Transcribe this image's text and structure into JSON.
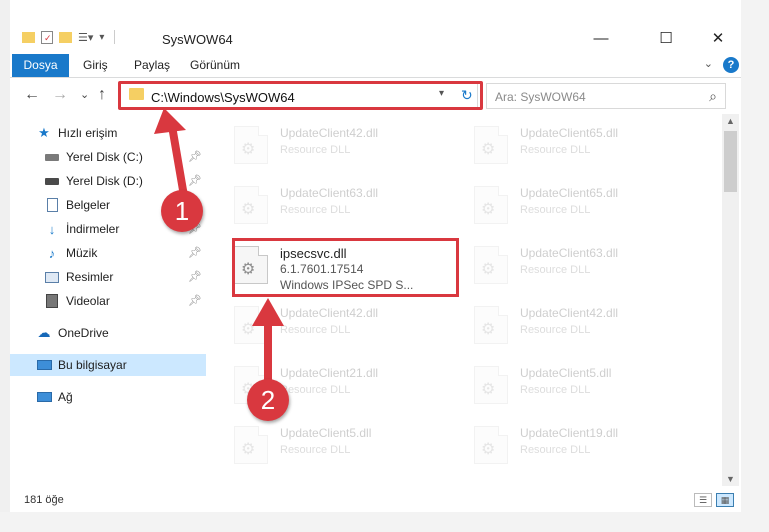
{
  "window": {
    "title": "SysWOW64",
    "minimize_glyph": "—",
    "maximize_glyph": "☐",
    "close_glyph": "✕"
  },
  "ribbon": {
    "tabs": [
      "Dosya",
      "Giriş",
      "Paylaş",
      "Görünüm"
    ]
  },
  "navbar": {
    "back_glyph": "←",
    "forward_glyph": "→",
    "recent_glyph": "⌄",
    "up_glyph": "↑",
    "address": "C:\\Windows\\SysWOW64",
    "search_placeholder": "Ara: SysWOW64"
  },
  "sidebar": {
    "items": [
      {
        "label": "Hızlı erişim",
        "icon": "star-icon",
        "pinned": false
      },
      {
        "label": "Yerel Disk (C:)",
        "icon": "drive-icon",
        "pinned": true
      },
      {
        "label": "Yerel Disk (D:)",
        "icon": "drive-icon",
        "pinned": true
      },
      {
        "label": "Belgeler",
        "icon": "documents-icon",
        "pinned": true
      },
      {
        "label": "İndirmeler",
        "icon": "download-icon",
        "pinned": true
      },
      {
        "label": "Müzik",
        "icon": "music-icon",
        "pinned": true
      },
      {
        "label": "Resimler",
        "icon": "pictures-icon",
        "pinned": true
      },
      {
        "label": "Videolar",
        "icon": "video-icon",
        "pinned": true
      },
      {
        "label": "OneDrive",
        "icon": "cloud-icon",
        "pinned": false
      },
      {
        "label": "Bu bilgisayar",
        "icon": "computer-icon",
        "pinned": false,
        "selected": true
      },
      {
        "label": "Ağ",
        "icon": "network-icon",
        "pinned": false
      }
    ]
  },
  "files": [
    {
      "name": "UpdateClient42.dll",
      "desc": "Resource DLL",
      "faded": true
    },
    {
      "name": "UpdateClient65.dll",
      "desc": "Resource DLL",
      "faded": true
    },
    {
      "name": "UpdateClient63.dll",
      "desc": "Resource DLL",
      "faded": true
    },
    {
      "name": "UpdateClient65.dll",
      "desc": "Resource DLL",
      "faded": true
    },
    {
      "name": "ipsecsvc.dll",
      "version": "6.1.7601.17514",
      "desc": "Windows IPSec SPD S...",
      "faded": false
    },
    {
      "name": "UpdateClient63.dll",
      "desc": "Resource DLL",
      "faded": true
    },
    {
      "name": "UpdateClient42.dll",
      "desc": "Resource DLL",
      "faded": true
    },
    {
      "name": "UpdateClient42.dll",
      "desc": "Resource DLL",
      "faded": true
    },
    {
      "name": "UpdateClient21.dll",
      "desc": "Resource DLL",
      "faded": true
    },
    {
      "name": "UpdateClient5.dll",
      "desc": "Resource DLL",
      "faded": true
    },
    {
      "name": "UpdateClient5.dll",
      "desc": "Resource DLL",
      "faded": true
    },
    {
      "name": "UpdateClient19.dll",
      "desc": "Resource DLL",
      "faded": true
    }
  ],
  "status": {
    "item_count": "181 öğe"
  },
  "annotations": {
    "step1": "1",
    "step2": "2",
    "highlight_color": "#d9383f"
  },
  "colors": {
    "accent": "#1979ca",
    "selection": "#cce8ff",
    "folder": "#f5cf63"
  }
}
